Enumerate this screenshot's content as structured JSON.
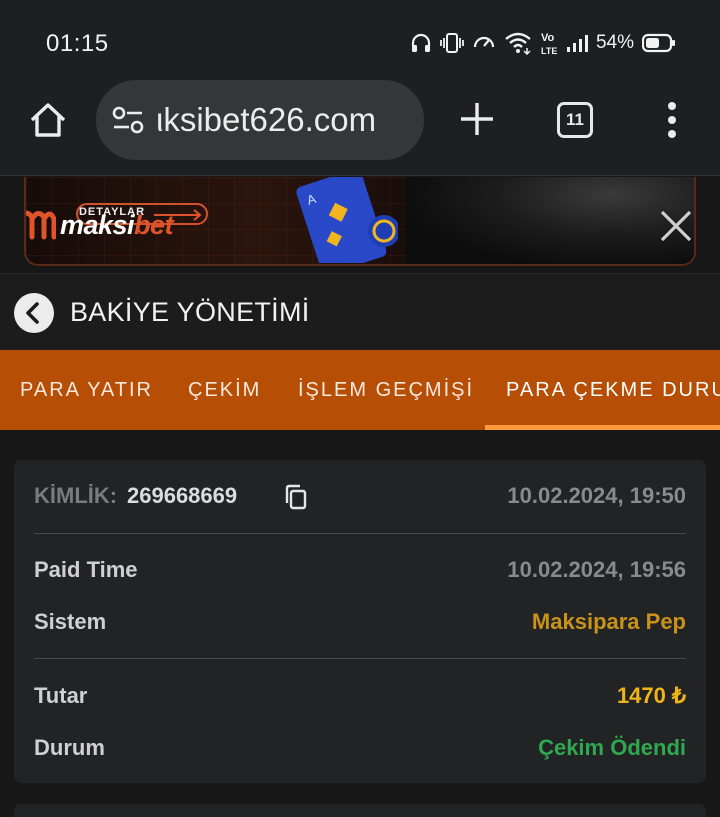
{
  "status_bar": {
    "time": "01:15",
    "battery": "54%",
    "icons": [
      "headphones-icon",
      "vibrate-icon",
      "data-saver-icon",
      "wifi-icon",
      "volte-icon",
      "signal-icon",
      "battery-icon"
    ],
    "volte_text": "Vo LTE"
  },
  "browser": {
    "url": "ιksibet626.com",
    "tab_count": "11"
  },
  "banner": {
    "details_label": "DETAYLAR",
    "logo_text_a": "maksi",
    "logo_text_b": "bet"
  },
  "header": {
    "title": "BAKİYE YÖNETİMİ"
  },
  "tabs": [
    {
      "label": "PARA YATIR"
    },
    {
      "label": "ÇEKİM"
    },
    {
      "label": "İŞLEM GEÇMİŞİ"
    },
    {
      "label": "PARA ÇEKME DURUMU"
    }
  ],
  "transaction": {
    "id_label": "KİMLİK:",
    "id_value": "269668669",
    "created": "10.02.2024, 19:50",
    "paid_time_label": "Paid Time",
    "paid_time_value": "10.02.2024, 19:56",
    "system_label": "Sistem",
    "system_value": "Maksipara Pep",
    "amount_label": "Tutar",
    "amount_value": "1470 ₺",
    "status_label": "Durum",
    "status_value": "Çekim Ödendi"
  },
  "colors": {
    "tab_bar": "#b64e06",
    "active_underline": "#ff9a3c",
    "system_value": "#c99319",
    "amount_value": "#f0b515",
    "status_value": "#2fa84f"
  }
}
